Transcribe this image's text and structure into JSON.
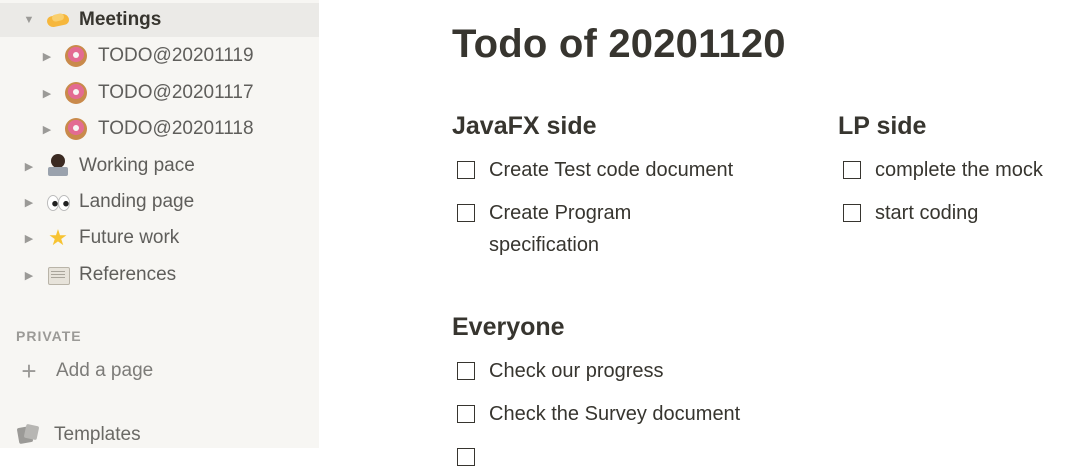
{
  "sidebar": {
    "items": [
      {
        "label": "Meetings",
        "icon": "handshake-icon",
        "expanded": true
      },
      {
        "label": "TODO@20201119",
        "icon": "donut-icon"
      },
      {
        "label": "TODO@20201117",
        "icon": "donut-icon"
      },
      {
        "label": "TODO@20201118",
        "icon": "donut-icon"
      },
      {
        "label": "Working pace",
        "icon": "technologist-icon"
      },
      {
        "label": "Landing page",
        "icon": "eyes-icon"
      },
      {
        "label": "Future work",
        "icon": "sparkle-star-icon"
      },
      {
        "label": "References",
        "icon": "scroll-icon"
      }
    ],
    "section_label": "PRIVATE",
    "add_page_label": "Add a page",
    "templates_label": "Templates"
  },
  "page": {
    "title": "Todo of 20201120",
    "sections": [
      {
        "heading": "JavaFX side",
        "todos": [
          "Create Test code document",
          "Create Program specification"
        ]
      },
      {
        "heading": "LP side",
        "todos": [
          "complete the mock",
          "start coding"
        ]
      },
      {
        "heading": "Everyone",
        "todos": [
          "Check our progress",
          "Check the Survey document"
        ]
      }
    ]
  },
  "colors": {
    "sidebar_bg": "#f7f6f3",
    "sidebar_active_bg": "#ebeae7",
    "text": "#37352f",
    "muted_text": "#9b9a97"
  }
}
